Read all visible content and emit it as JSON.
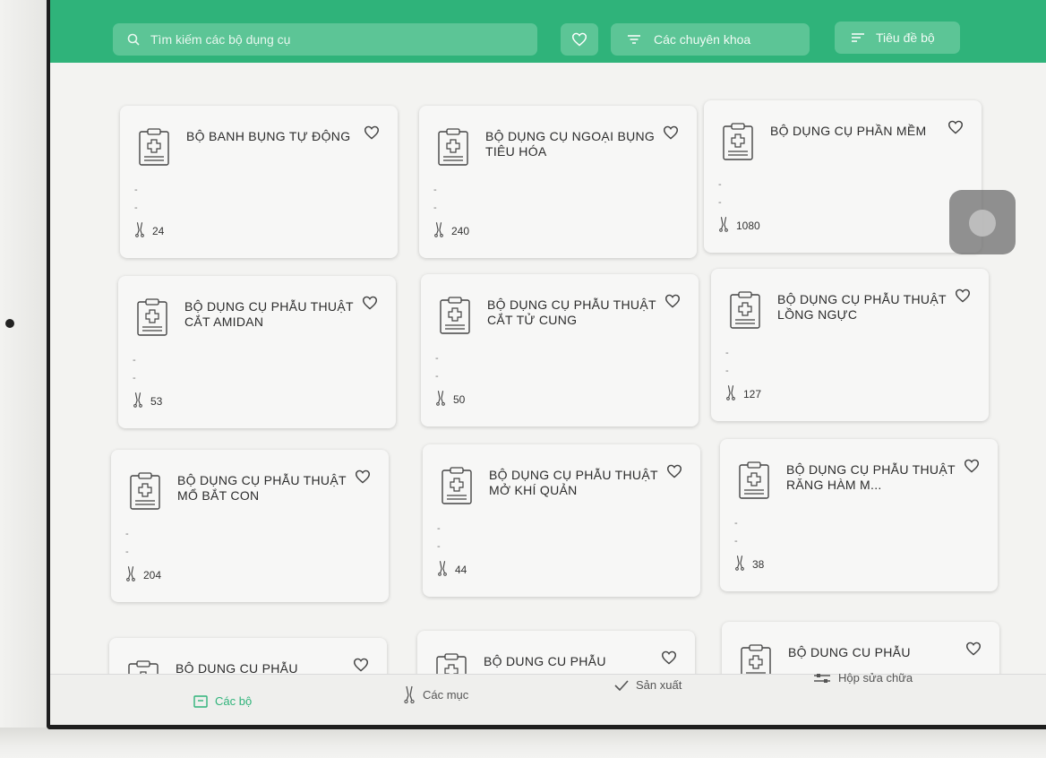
{
  "header": {
    "search_placeholder": "Tìm kiếm các bộ dụng cụ",
    "specialties_label": "Các chuyên khoa",
    "sort_label": "Tiêu đề bộ"
  },
  "cards": [
    {
      "title": "BỘ BANH BỤNG TỰ ĐỘNG",
      "line1": "-",
      "line2": "-",
      "count": "24"
    },
    {
      "title": "BỘ DỤNG CỤ NGOẠI BỤNG TIÊU HÓA",
      "line1": "-",
      "line2": "-",
      "count": "240"
    },
    {
      "title": "BỘ DỤNG CỤ PHẦN MỀM",
      "line1": "-",
      "line2": "-",
      "count": "1080"
    },
    {
      "title": "BỘ DỤNG CỤ PHẪU THUẬT CẮT AMIDAN",
      "line1": "-",
      "line2": "-",
      "count": "53"
    },
    {
      "title": "BỘ DỤNG CỤ PHẪU THUẬT CẮT TỬ CUNG",
      "line1": "-",
      "line2": "-",
      "count": "50"
    },
    {
      "title": "BỘ DỤNG CỤ PHẪU THUẬT LỒNG NGỰC",
      "line1": "-",
      "line2": "-",
      "count": "127"
    },
    {
      "title": "BỘ DỤNG CỤ PHẪU THUẬT MỔ BẮT CON",
      "line1": "-",
      "line2": "-",
      "count": "204"
    },
    {
      "title": "BỘ DỤNG CỤ PHẪU THUẬT MỞ KHÍ QUẢN",
      "line1": "-",
      "line2": "-",
      "count": "44"
    },
    {
      "title": "BỘ DỤNG CỤ PHẪU THUẬT RĂNG HÀM M...",
      "line1": "-",
      "line2": "-",
      "count": "38"
    },
    {
      "title": "BỘ DUNG CU PHẪU"
    },
    {
      "title": "BỘ DUNG CU PHẪU"
    },
    {
      "title": "BỘ DUNG CU PHẪU"
    }
  ],
  "bottom_nav": [
    {
      "label": "Các bộ",
      "icon": "kit-box-icon",
      "active": true
    },
    {
      "label": "Các mục",
      "icon": "instrument-icon",
      "active": false
    },
    {
      "label": "Sản xuất",
      "icon": "check-icon",
      "active": false
    },
    {
      "label": "Hộp sửa chữa",
      "icon": "repair-box-icon",
      "active": false
    }
  ],
  "colors": {
    "brand_green": "#2fb37a",
    "search_fill": "#5cc596"
  }
}
